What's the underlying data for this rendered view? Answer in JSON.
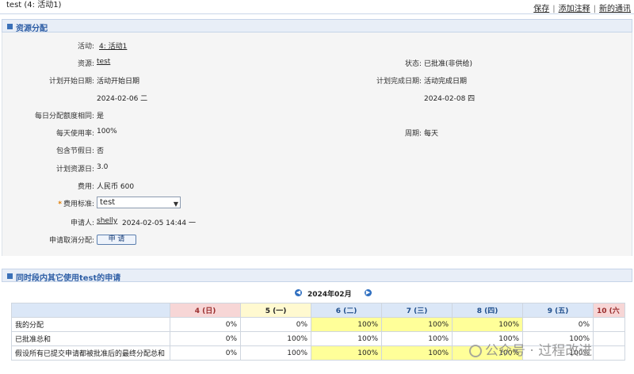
{
  "page": {
    "title": "test (4: 活动1)",
    "links": {
      "save": "保存",
      "add_note": "添加注释",
      "new_notice": "新的通讯"
    }
  },
  "section1": {
    "header": "资源分配",
    "activity": {
      "label": "活动:",
      "value": "4: 活动1"
    },
    "resource": {
      "label": "资源:",
      "value": "test"
    },
    "status": {
      "label": "状态:",
      "value": "已批准(非供给)"
    },
    "plan_start": {
      "label": "计划开始日期:",
      "value": "活动开始日期",
      "date": "2024-02-06 二"
    },
    "plan_end": {
      "label": "计划完成日期:",
      "value": "活动完成日期",
      "date": "2024-02-08 四"
    },
    "daily_same": {
      "label": "每日分配额度相同:",
      "value": "是"
    },
    "daily_rate": {
      "label": "每天使用率:",
      "value": "100%"
    },
    "period": {
      "label": "周期:",
      "value": "每天"
    },
    "holidays": {
      "label": "包含节假日:",
      "value": "否"
    },
    "plan_days": {
      "label": "计划资源日:",
      "value": "3.0"
    },
    "cost": {
      "label": "费用:",
      "value": "人民币 600"
    },
    "cost_std": {
      "label": "费用标准:",
      "required": "*",
      "selected": "test"
    },
    "applicant": {
      "label": "申请人:",
      "name": "shelly",
      "time": "2024-02-05 14:44 一"
    },
    "cancel": {
      "label": "申请取消分配:",
      "button": "申 请"
    }
  },
  "section2": {
    "header": "同时段内其它使用test的申请",
    "month": "2024年02月",
    "columns": [
      "4 (日)",
      "5 (一)",
      "6 (二)",
      "7 (三)",
      "8 (四)",
      "9 (五)",
      "10 (六"
    ],
    "rows": [
      {
        "label": "我的分配",
        "values": [
          "0%",
          "0%",
          "100%",
          "100%",
          "100%",
          "0%",
          ""
        ]
      },
      {
        "label": "已批准总和",
        "values": [
          "0%",
          "100%",
          "100%",
          "100%",
          "100%",
          "100%",
          ""
        ]
      },
      {
        "label": "假设所有已提交申请都被批准后的最终分配总和",
        "values": [
          "0%",
          "100%",
          "100%",
          "100%",
          "100%",
          "100%",
          ""
        ]
      }
    ]
  },
  "watermark": "公众号 · 过程改进"
}
